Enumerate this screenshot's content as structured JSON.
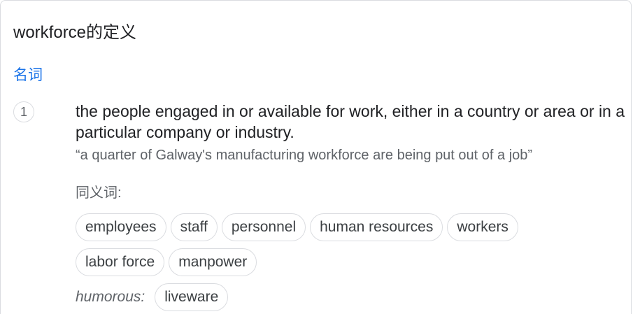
{
  "title": "workforce的定义",
  "part_of_speech": "名词",
  "senses": [
    {
      "number": "1",
      "definition": "the people engaged in or available for work, either in a country or area or in a particular company or industry.",
      "example": "“a quarter of Galway's manufacturing workforce are being put out of a job”",
      "synonyms_label": "同义词:",
      "synonyms_row1": [
        "employees",
        "staff",
        "personnel",
        "human resources",
        "workers"
      ],
      "synonyms_row2": [
        "labor force",
        "manpower"
      ],
      "register_label": "humorous:",
      "register_synonyms": [
        "liveware"
      ]
    }
  ]
}
